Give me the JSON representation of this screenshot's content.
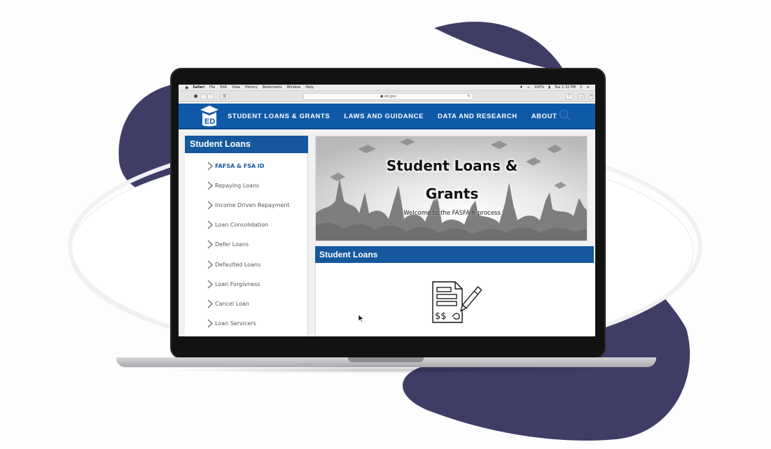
{
  "colors": {
    "brand_blue": "#15589e",
    "nav_blue": "#0f5aa8",
    "blob_purple": "#3f3c66"
  },
  "menubar": {
    "app": "Safari",
    "items": [
      "File",
      "Edit",
      "View",
      "History",
      "Bookmarks",
      "Window",
      "Help"
    ],
    "battery": "100%",
    "clock": "Tue 1:32 PM"
  },
  "browser": {
    "address": "ed.gov"
  },
  "nav": {
    "logo": "ED",
    "links": [
      "STUDENT LOANS & GRANTS",
      "LAWS AND GUIDANCE",
      "DATA AND RESEARCH",
      "ABOUT"
    ],
    "search_icon": "search-icon"
  },
  "sidebar": {
    "title": "Student Loans",
    "items": [
      {
        "label": "FAFSA & FSA ID",
        "active": true
      },
      {
        "label": "Repaying Loans"
      },
      {
        "label": "Income Driven Repayment"
      },
      {
        "label": "Loan Consolidation"
      },
      {
        "label": "Defer Loans"
      },
      {
        "label": "Defaulted Loans"
      },
      {
        "label": "Loan Forgivness"
      },
      {
        "label": "Cancel Loan"
      },
      {
        "label": "Loan Servicers"
      }
    ]
  },
  "hero": {
    "title": "Student Loans &\nGrants",
    "subtitle": "Welcome to the FASFA® process"
  },
  "panel": {
    "title": "Student Loans",
    "icon": "document-dollar-pen-icon",
    "icon_text": "$$"
  }
}
